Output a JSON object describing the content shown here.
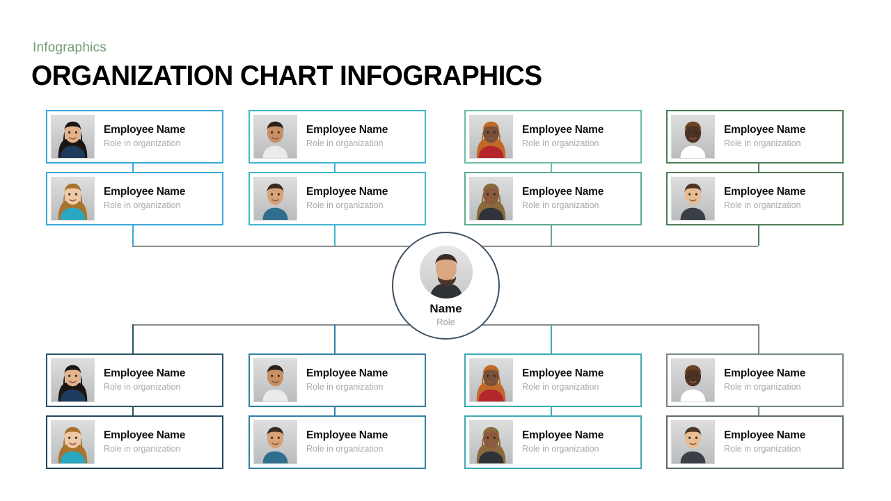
{
  "header": {
    "eyebrow": "Infographics",
    "eyebrow_color": "#6f9b74",
    "title": "ORGANIZATION CHART INFOGRAPHICS",
    "title_color": "#000000"
  },
  "center_node": {
    "name": "Name",
    "role": "Role",
    "border_color": "#3c5063",
    "photo": "portrait-photo"
  },
  "connector": {
    "bus_color": "#8c8c8c"
  },
  "top_section": {
    "rows": [
      {
        "cards": [
          {
            "name": "Employee Name",
            "role": "Role in organization",
            "border_color": "#3aa8d8",
            "photo": "portrait-photo"
          },
          {
            "name": "Employee Name",
            "role": "Role in organization",
            "border_color": "#3fb7ce",
            "photo": "portrait-photo"
          },
          {
            "name": "Employee Name",
            "role": "Role in organization",
            "border_color": "#6cbda6",
            "photo": "portrait-photo"
          },
          {
            "name": "Employee Name",
            "role": "Role in organization",
            "border_color": "#4f7f55",
            "photo": "portrait-photo"
          }
        ]
      },
      {
        "cards": [
          {
            "name": "Employee Name",
            "role": "Role in organization",
            "border_color": "#3aa8d8",
            "photo": "portrait-photo"
          },
          {
            "name": "Employee Name",
            "role": "Role in organization",
            "border_color": "#3fb7ce",
            "photo": "portrait-photo"
          },
          {
            "name": "Employee Name",
            "role": "Role in organization",
            "border_color": "#5fae8c",
            "photo": "portrait-photo"
          },
          {
            "name": "Employee Name",
            "role": "Role in organization",
            "border_color": "#4f7f55",
            "photo": "portrait-photo"
          }
        ]
      }
    ]
  },
  "bottom_section": {
    "rows": [
      {
        "cards": [
          {
            "name": "Employee Name",
            "role": "Role in organization",
            "border_color": "#2b5568",
            "photo": "portrait-photo"
          },
          {
            "name": "Employee Name",
            "role": "Role in organization",
            "border_color": "#2f7fa8",
            "photo": "portrait-photo"
          },
          {
            "name": "Employee Name",
            "role": "Role in organization",
            "border_color": "#3fa9b5",
            "photo": "portrait-photo"
          },
          {
            "name": "Employee Name",
            "role": "Role in organization",
            "border_color": "#77877c",
            "photo": "portrait-photo"
          }
        ]
      },
      {
        "cards": [
          {
            "name": "Employee Name",
            "role": "Role in organization",
            "border_color": "#24475c",
            "photo": "portrait-photo"
          },
          {
            "name": "Employee Name",
            "role": "Role in organization",
            "border_color": "#2f7fa8",
            "photo": "portrait-photo"
          },
          {
            "name": "Employee Name",
            "role": "Role in organization",
            "border_color": "#3fa9b5",
            "photo": "portrait-photo"
          },
          {
            "name": "Employee Name",
            "role": "Role in organization",
            "border_color": "#5c6f60",
            "photo": "portrait-photo"
          }
        ]
      }
    ]
  }
}
